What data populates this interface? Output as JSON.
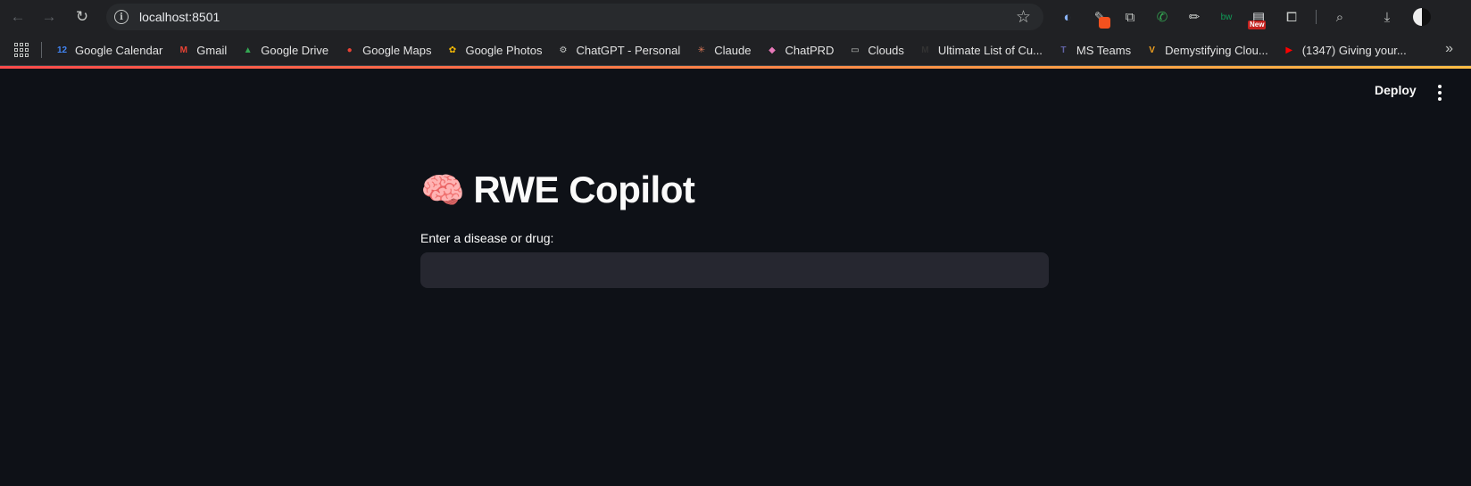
{
  "browser": {
    "url": "localhost:8501",
    "bookmarks": [
      {
        "label": "Google Calendar",
        "icon": "calendar-icon",
        "color": "#4285f4",
        "glyph": "12"
      },
      {
        "label": "Gmail",
        "icon": "gmail-icon",
        "color": "#ea4335",
        "glyph": "M"
      },
      {
        "label": "Google Drive",
        "icon": "drive-icon",
        "color": "#34a853",
        "glyph": "▲"
      },
      {
        "label": "Google Maps",
        "icon": "maps-icon",
        "color": "#ea4335",
        "glyph": "●"
      },
      {
        "label": "Google Photos",
        "icon": "photos-icon",
        "color": "#fbbc04",
        "glyph": "✿"
      },
      {
        "label": "ChatGPT - Personal",
        "icon": "chatgpt-icon",
        "color": "#c4c7c5",
        "glyph": "⚙"
      },
      {
        "label": "Claude",
        "icon": "claude-icon",
        "color": "#d97757",
        "glyph": "✳"
      },
      {
        "label": "ChatPRD",
        "icon": "chatprd-icon",
        "color": "#e879b9",
        "glyph": "◆"
      },
      {
        "label": "Clouds",
        "icon": "folder-icon",
        "color": "#c4c7c5",
        "glyph": "▭"
      },
      {
        "label": "Ultimate List of Cu...",
        "icon": "medium-icon",
        "color": "#333",
        "glyph": "M"
      },
      {
        "label": "MS Teams",
        "icon": "teams-icon",
        "color": "#6264a7",
        "glyph": "T"
      },
      {
        "label": "Demystifying Clou...",
        "icon": "vercel-v-icon",
        "color": "#f0a020",
        "glyph": "V"
      },
      {
        "label": "(1347) Giving your...",
        "icon": "youtube-icon",
        "color": "#ff0000",
        "glyph": "▶"
      }
    ],
    "extension_badge": "New"
  },
  "app": {
    "deploy_label": "Deploy",
    "title_emoji": "🧠",
    "title_text": "RWE Copilot",
    "input_label": "Enter a disease or drug:",
    "input_value": ""
  }
}
